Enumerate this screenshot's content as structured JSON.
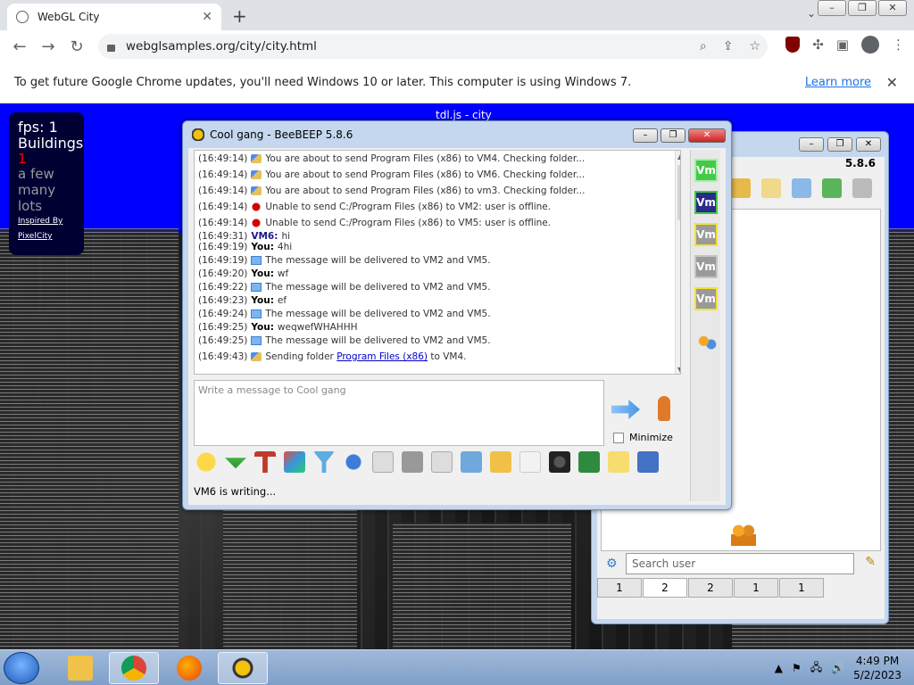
{
  "browser": {
    "tab_title": "WebGL City",
    "url": "webglsamples.org/city/city.html",
    "infobar_text": "To get future Google Chrome updates, you'll need Windows 10 or later. This computer is using Windows 7.",
    "infobar_link": "Learn more"
  },
  "scene": {
    "title": "tdl.js - city",
    "fps": "fps: 1",
    "buildings_label": "Buildings",
    "buildings_value": "1",
    "options": [
      "a few",
      "many",
      "lots"
    ],
    "credit_1": "Inspired By",
    "credit_2": "PixelCity"
  },
  "chat_window": {
    "title": "Cool gang - BeeBEEP 5.8.6",
    "log": [
      {
        "ts": "(16:49:14)",
        "icon": "file",
        "text": "You are about to send Program Files (x86) to VM4. Checking folder..."
      },
      {
        "ts": "(16:49:14)",
        "icon": "file",
        "text": "You are about to send Program Files (x86) to VM6. Checking folder..."
      },
      {
        "ts": "(16:49:14)",
        "icon": "file",
        "text": "You are about to send Program Files (x86) to vm3. Checking folder..."
      },
      {
        "ts": "(16:49:14)",
        "icon": "err",
        "text": "Unable to send C:/Program Files (x86) to VM2: user is offline."
      },
      {
        "ts": "(16:49:14)",
        "icon": "err",
        "text": "Unable to send C:/Program Files (x86) to VM5: user is offline."
      },
      {
        "ts": "(16:49:31)",
        "who": "VM6:",
        "text": "hi"
      },
      {
        "ts": "(16:49:19)",
        "who": "You:",
        "text": "4hi"
      },
      {
        "ts": "(16:49:19)",
        "icon": "mail",
        "text": "The message will be delivered to VM2 and VM5."
      },
      {
        "ts": "(16:49:20)",
        "who": "You:",
        "text": "wf"
      },
      {
        "ts": "(16:49:22)",
        "icon": "mail",
        "text": "The message will be delivered to VM2 and VM5."
      },
      {
        "ts": "(16:49:23)",
        "who": "You:",
        "text": "ef"
      },
      {
        "ts": "(16:49:24)",
        "icon": "mail",
        "text": "The message will be delivered to VM2 and VM5."
      },
      {
        "ts": "(16:49:25)",
        "who": "You:",
        "text": "weqwefWHAHHH"
      },
      {
        "ts": "(16:49:25)",
        "icon": "mail",
        "text": "The message will be delivered to VM2 and VM5."
      },
      {
        "ts": "(16:49:43)",
        "icon": "file",
        "text": "Sending folder",
        "link": "Program Files (x86)",
        "after": "to VM4."
      }
    ],
    "input_placeholder": "Write a message to Cool gang",
    "minimize_label": "Minimize",
    "status": "VM6 is writing...",
    "vm_label": "Vm"
  },
  "users_window": {
    "version": "5.8.6",
    "search_placeholder": "Search user",
    "tabs": [
      "1",
      "2",
      "2",
      "1",
      "1"
    ]
  },
  "taskbar": {
    "time": "4:49 PM",
    "date": "5/2/2023"
  }
}
